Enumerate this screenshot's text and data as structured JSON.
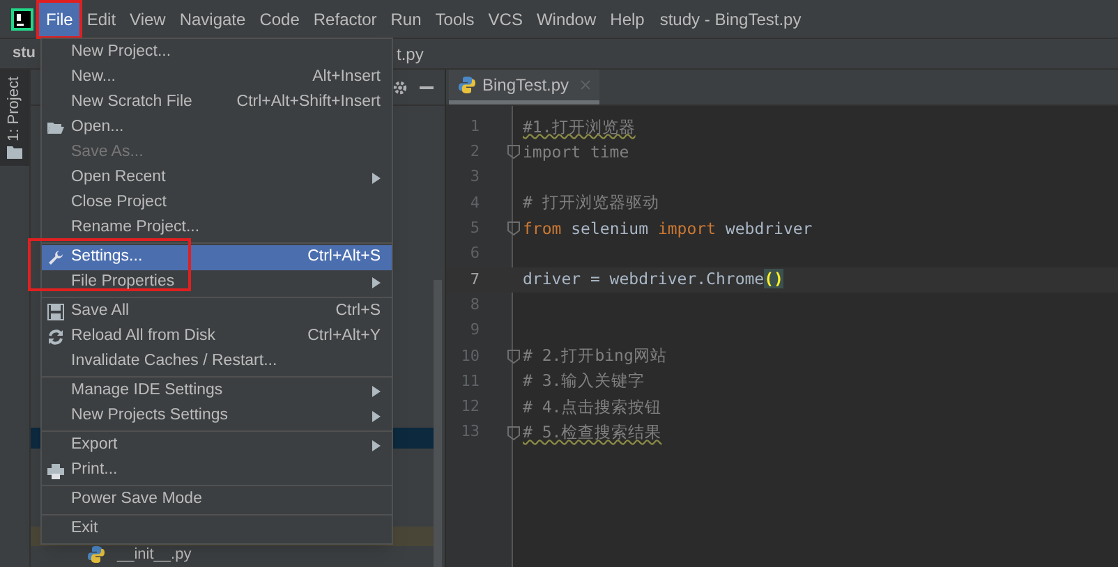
{
  "menubar": {
    "items": [
      {
        "label": "File",
        "selected": true,
        "highlighted": true
      },
      {
        "label": "Edit",
        "selected": false,
        "highlighted": false
      },
      {
        "label": "View",
        "selected": false,
        "highlighted": false
      },
      {
        "label": "Navigate",
        "selected": false,
        "highlighted": false
      },
      {
        "label": "Code",
        "selected": false,
        "highlighted": false
      },
      {
        "label": "Refactor",
        "selected": false,
        "highlighted": false
      },
      {
        "label": "Run",
        "selected": false,
        "highlighted": false
      },
      {
        "label": "Tools",
        "selected": false,
        "highlighted": false
      },
      {
        "label": "VCS",
        "selected": false,
        "highlighted": false
      },
      {
        "label": "Window",
        "selected": false,
        "highlighted": false
      },
      {
        "label": "Help",
        "selected": false,
        "highlighted": false
      }
    ],
    "title": "study - BingTest.py"
  },
  "navigation_bar": {
    "project": "stu",
    "file": "t.py"
  },
  "tool_window_strip": {
    "tab": {
      "label": "1: Project",
      "selected": true
    }
  },
  "project_panel": {
    "file": "__init__.py"
  },
  "file_menu": {
    "items": [
      {
        "kind": "item",
        "label": "New Project...",
        "selected": false,
        "disabled": false,
        "submenu": false
      },
      {
        "kind": "item",
        "label": "New...",
        "shortcut": "Alt+Insert",
        "selected": false,
        "disabled": false,
        "submenu": false
      },
      {
        "kind": "item",
        "label": "New Scratch File",
        "shortcut": "Ctrl+Alt+Shift+Insert",
        "selected": false,
        "disabled": false,
        "submenu": false
      },
      {
        "kind": "item",
        "label": "Open...",
        "selected": false,
        "disabled": false,
        "submenu": false
      },
      {
        "kind": "item",
        "label": "Save As...",
        "selected": false,
        "disabled": true,
        "submenu": false
      },
      {
        "kind": "item",
        "label": "Open Recent",
        "selected": false,
        "disabled": false,
        "submenu": true
      },
      {
        "kind": "item",
        "label": "Close Project",
        "selected": false,
        "disabled": false,
        "submenu": false
      },
      {
        "kind": "item",
        "label": "Rename Project...",
        "selected": false,
        "disabled": false,
        "submenu": false
      },
      {
        "kind": "separator"
      },
      {
        "kind": "item",
        "label": "Settings...",
        "shortcut": "Ctrl+Alt+S",
        "selected": true,
        "disabled": false,
        "submenu": false,
        "highlighted": true
      },
      {
        "kind": "item",
        "label": "File Properties",
        "selected": false,
        "disabled": false,
        "submenu": true
      },
      {
        "kind": "separator"
      },
      {
        "kind": "item",
        "label": "Save All",
        "shortcut": "Ctrl+S",
        "selected": false,
        "disabled": false,
        "submenu": false
      },
      {
        "kind": "item",
        "label": "Reload All from Disk",
        "shortcut": "Ctrl+Alt+Y",
        "selected": false,
        "disabled": false,
        "submenu": false
      },
      {
        "kind": "item",
        "label": "Invalidate Caches / Restart...",
        "selected": false,
        "disabled": false,
        "submenu": false
      },
      {
        "kind": "separator"
      },
      {
        "kind": "item",
        "label": "Manage IDE Settings",
        "selected": false,
        "disabled": false,
        "submenu": true
      },
      {
        "kind": "item",
        "label": "New Projects Settings",
        "selected": false,
        "disabled": false,
        "submenu": true
      },
      {
        "kind": "separator"
      },
      {
        "kind": "item",
        "label": "Export",
        "selected": false,
        "disabled": false,
        "submenu": true
      },
      {
        "kind": "item",
        "label": "Print...",
        "selected": false,
        "disabled": false,
        "submenu": false
      },
      {
        "kind": "separator"
      },
      {
        "kind": "item",
        "label": "Power Save Mode",
        "selected": false,
        "disabled": false,
        "submenu": false
      },
      {
        "kind": "separator"
      },
      {
        "kind": "item",
        "label": "Exit",
        "selected": false,
        "disabled": false,
        "submenu": false
      }
    ]
  },
  "editor": {
    "tabs": [
      {
        "label": "BingTest.py",
        "selected": true
      }
    ],
    "lines": [
      {
        "number": "1",
        "current": false,
        "fold": false,
        "typo": true,
        "tokens": [
          {
            "text": "#1.打开浏览器",
            "kind": "comment"
          }
        ]
      },
      {
        "number": "2",
        "current": false,
        "fold": true,
        "typo": false,
        "tokens": [
          {
            "text": "import time",
            "kind": "unused"
          }
        ]
      },
      {
        "number": "3",
        "current": false,
        "fold": false
      },
      {
        "number": "4",
        "current": false,
        "fold": false,
        "typo": false,
        "tokens": [
          {
            "text": "# 打开浏览器驱动",
            "kind": "comment"
          }
        ]
      },
      {
        "number": "5",
        "current": false,
        "fold": true,
        "typo": false,
        "tokens": [
          {
            "text": "from",
            "kind": "keyword"
          },
          {
            "text": " selenium ",
            "kind": "plain"
          },
          {
            "text": "import",
            "kind": "keyword"
          },
          {
            "text": " webdriver",
            "kind": "plain"
          }
        ]
      },
      {
        "number": "6",
        "current": false,
        "fold": false
      },
      {
        "number": "7",
        "current": true,
        "fold": false,
        "typo": false,
        "tokens": [
          {
            "text": "driver = webdriver.Chrome",
            "kind": "plain"
          },
          {
            "text": "()",
            "kind": "brace_match"
          }
        ]
      },
      {
        "number": "8",
        "current": false,
        "fold": false
      },
      {
        "number": "9",
        "current": false,
        "fold": false
      },
      {
        "number": "10",
        "current": false,
        "fold": true,
        "typo": false,
        "tokens": [
          {
            "text": "# 2.打开bing网站",
            "kind": "comment"
          }
        ]
      },
      {
        "number": "11",
        "current": false,
        "fold": false,
        "typo": false,
        "tokens": [
          {
            "text": "# 3.输入关键字",
            "kind": "comment"
          }
        ]
      },
      {
        "number": "12",
        "current": false,
        "fold": false,
        "typo": false,
        "tokens": [
          {
            "text": "# 4.点击搜索按钮",
            "kind": "comment"
          }
        ]
      },
      {
        "number": "13",
        "current": false,
        "fold": true,
        "typo": true,
        "tokens": [
          {
            "text": "# 5.检查搜索结果",
            "kind": "comment"
          }
        ]
      }
    ]
  }
}
